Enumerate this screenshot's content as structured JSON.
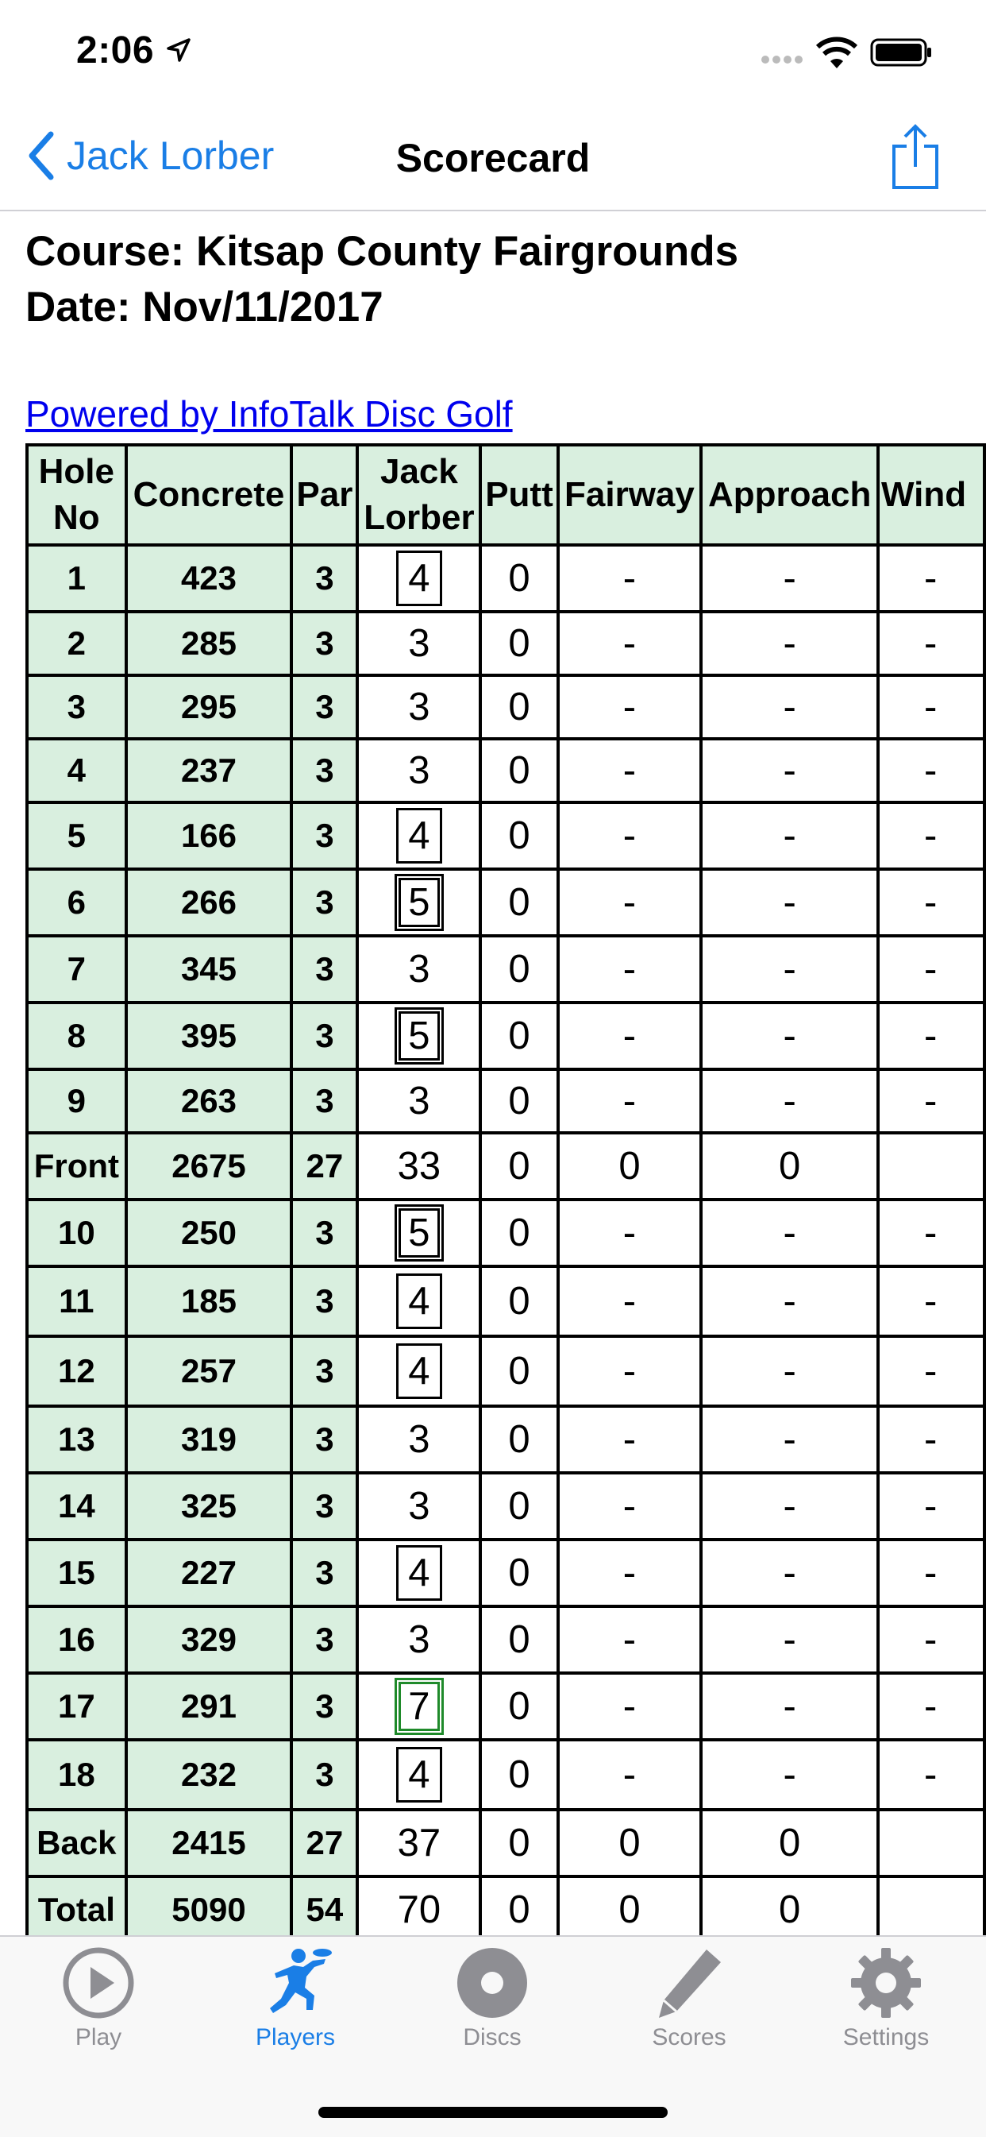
{
  "status_bar": {
    "time": "2:06"
  },
  "nav": {
    "back_label": "Jack Lorber",
    "title": "Scorecard"
  },
  "card": {
    "course": "Course: Kitsap County Fairgrounds",
    "date": "Date: Nov/11/2017",
    "powered_by": "Powered by InfoTalk Disc Golf"
  },
  "table": {
    "headers": {
      "hole": [
        "Hole",
        "No"
      ],
      "length": "Concrete",
      "par": "Par",
      "player": [
        "Jack",
        "Lorber"
      ],
      "putt": "Putt",
      "fairway": "Fairway",
      "approach": "Approach",
      "wind": "Wind"
    },
    "rows": [
      {
        "hole": "1",
        "len": "423",
        "par": "3",
        "score": "4",
        "mark": "bogey",
        "putt": "0",
        "fairway": "-",
        "approach": "-",
        "wind": "-"
      },
      {
        "hole": "2",
        "len": "285",
        "par": "3",
        "score": "3",
        "mark": "",
        "putt": "0",
        "fairway": "-",
        "approach": "-",
        "wind": "-"
      },
      {
        "hole": "3",
        "len": "295",
        "par": "3",
        "score": "3",
        "mark": "",
        "putt": "0",
        "fairway": "-",
        "approach": "-",
        "wind": "-"
      },
      {
        "hole": "4",
        "len": "237",
        "par": "3",
        "score": "3",
        "mark": "",
        "putt": "0",
        "fairway": "-",
        "approach": "-",
        "wind": "-"
      },
      {
        "hole": "5",
        "len": "166",
        "par": "3",
        "score": "4",
        "mark": "bogey",
        "putt": "0",
        "fairway": "-",
        "approach": "-",
        "wind": "-"
      },
      {
        "hole": "6",
        "len": "266",
        "par": "3",
        "score": "5",
        "mark": "double",
        "putt": "0",
        "fairway": "-",
        "approach": "-",
        "wind": "-"
      },
      {
        "hole": "7",
        "len": "345",
        "par": "3",
        "score": "3",
        "mark": "",
        "putt": "0",
        "fairway": "-",
        "approach": "-",
        "wind": "-"
      },
      {
        "hole": "8",
        "len": "395",
        "par": "3",
        "score": "5",
        "mark": "double",
        "putt": "0",
        "fairway": "-",
        "approach": "-",
        "wind": "-"
      },
      {
        "hole": "9",
        "len": "263",
        "par": "3",
        "score": "3",
        "mark": "",
        "putt": "0",
        "fairway": "-",
        "approach": "-",
        "wind": "-"
      },
      {
        "hole": "Front",
        "len": "2675",
        "par": "27",
        "score": "33",
        "mark": "",
        "putt": "0",
        "fairway": "0",
        "approach": "0",
        "wind": ""
      },
      {
        "hole": "10",
        "len": "250",
        "par": "3",
        "score": "5",
        "mark": "double",
        "putt": "0",
        "fairway": "-",
        "approach": "-",
        "wind": "-"
      },
      {
        "hole": "11",
        "len": "185",
        "par": "3",
        "score": "4",
        "mark": "bogey",
        "putt": "0",
        "fairway": "-",
        "approach": "-",
        "wind": "-"
      },
      {
        "hole": "12",
        "len": "257",
        "par": "3",
        "score": "4",
        "mark": "bogey",
        "putt": "0",
        "fairway": "-",
        "approach": "-",
        "wind": "-"
      },
      {
        "hole": "13",
        "len": "319",
        "par": "3",
        "score": "3",
        "mark": "",
        "putt": "0",
        "fairway": "-",
        "approach": "-",
        "wind": "-"
      },
      {
        "hole": "14",
        "len": "325",
        "par": "3",
        "score": "3",
        "mark": "",
        "putt": "0",
        "fairway": "-",
        "approach": "-",
        "wind": "-"
      },
      {
        "hole": "15",
        "len": "227",
        "par": "3",
        "score": "4",
        "mark": "bogey",
        "putt": "0",
        "fairway": "-",
        "approach": "-",
        "wind": "-"
      },
      {
        "hole": "16",
        "len": "329",
        "par": "3",
        "score": "3",
        "mark": "",
        "putt": "0",
        "fairway": "-",
        "approach": "-",
        "wind": "-"
      },
      {
        "hole": "17",
        "len": "291",
        "par": "3",
        "score": "7",
        "mark": "green",
        "putt": "0",
        "fairway": "-",
        "approach": "-",
        "wind": "-"
      },
      {
        "hole": "18",
        "len": "232",
        "par": "3",
        "score": "4",
        "mark": "bogey",
        "putt": "0",
        "fairway": "-",
        "approach": "-",
        "wind": "-"
      },
      {
        "hole": "Back",
        "len": "2415",
        "par": "27",
        "score": "37",
        "mark": "",
        "putt": "0",
        "fairway": "0",
        "approach": "0",
        "wind": ""
      },
      {
        "hole": "Total",
        "len": "5090",
        "par": "54",
        "score": "70",
        "mark": "",
        "putt": "0",
        "fairway": "0",
        "approach": "0",
        "wind": ""
      }
    ],
    "row_heights": null
  },
  "tabs": [
    {
      "label": "Play",
      "icon": "play-icon",
      "active": false
    },
    {
      "label": "Players",
      "icon": "player-throwing-icon",
      "active": true
    },
    {
      "label": "Discs",
      "icon": "disc-icon",
      "active": false
    },
    {
      "label": "Scores",
      "icon": "pencil-icon",
      "active": false
    },
    {
      "label": "Settings",
      "icon": "gear-icon",
      "active": false
    }
  ],
  "colors": {
    "accent": "#1a7ee6",
    "cell_green": "#d9efdf",
    "inactive": "#8e8e93",
    "eagle_green": "#1f8a2a"
  }
}
